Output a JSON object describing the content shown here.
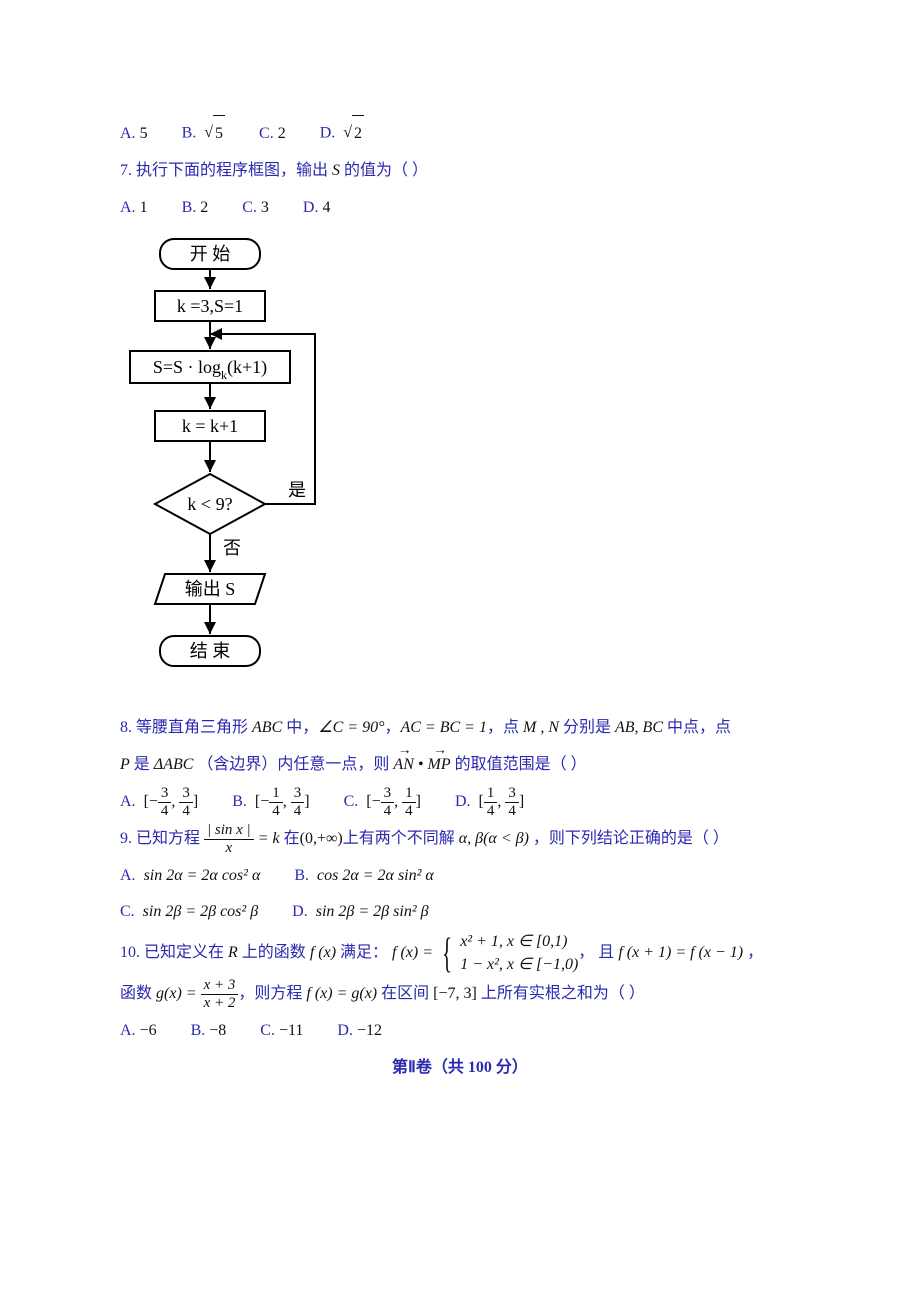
{
  "q6": {
    "a_label": "A.",
    "a_val": "5",
    "b_label": "B.",
    "b_sqrt": "5",
    "c_label": "C.",
    "c_val": "2",
    "d_label": "D.",
    "d_sqrt": "2"
  },
  "q7": {
    "num": "7.",
    "text": "执行下面的程序框图，输出",
    "svar": "S",
    "text2": "的值为（     ）",
    "a_label": "A.",
    "a_val": "1",
    "b_label": "B.",
    "b_val": "2",
    "c_label": "C.",
    "c_val": "3",
    "d_label": "D.",
    "d_val": "4",
    "flow": {
      "start": "开  始",
      "init": "k =3,S=1",
      "step1_a": "S=S · log",
      "step1_sub": "k",
      "step1_b": "(k+1)",
      "step2": "k = k+1",
      "cond": "k < 9?",
      "yes": "是",
      "no": "否",
      "out": "输出 S",
      "end": "结  束"
    }
  },
  "q8": {
    "num": "8.",
    "t1": "等腰直角三角形",
    "abc": "ABC",
    "t2": "中，",
    "angle": "∠C = 90°",
    "comma1": "，",
    "eq": "AC = BC = 1",
    "t3": "，点",
    "mn": "M , N",
    "t4": "分别是",
    "abbc": "AB, BC",
    "t5": "中点，点",
    "pvar": "P",
    "t6": "是",
    "tri": "ΔABC",
    "t7": "（含边界）内任意一点，则",
    "vec1": "AN",
    "dot": "•",
    "vec2": "MP",
    "t8": "的取值范围是（     ）",
    "opts": {
      "a": "A.",
      "b": "B.",
      "c": "C.",
      "d": "D.",
      "n3": "3",
      "n1": "1",
      "d4": "4"
    }
  },
  "q9": {
    "num": "9.",
    "t1": "已知方程",
    "frac_num": "| sin x |",
    "frac_den": "x",
    "eqk": "= k",
    "t2": "在",
    "interval": "(0,+∞)",
    "t3": "上有两个不同解",
    "ab": "α, β(α < β)",
    "t4": "，则下列结论正确的是（     ）",
    "optA_l": "A.",
    "optA": "sin 2α = 2α cos² α",
    "optB_l": "B.",
    "optB": "cos 2α = 2α sin² α",
    "optC_l": "C.",
    "optC": "sin 2β = 2β cos² β",
    "optD_l": "D.",
    "optD": "sin 2β = 2β sin² β"
  },
  "q10": {
    "num": "10.",
    "t1": "已知定义在",
    "R": "R",
    "t2": "上的函数",
    "fx": "f (x)",
    "t3": "满足：",
    "fxeq": "f (x) =",
    "case1": "x² + 1, x ∈ [0,1)",
    "case2": "1 − x², x ∈ [−1,0)",
    "t4": "， 且",
    "period": "f (x + 1) = f (x − 1)",
    "t5": "，",
    "t6": "函数",
    "gx": "g(x) =",
    "gnum": "x + 3",
    "gden": "x + 2",
    "t7": "，则方程",
    "fxg": "f (x) = g(x)",
    "t8": "在区间",
    "int": "[−7, 3]",
    "t9": "上所有实根之和为（     ）",
    "a_l": "A.",
    "a": "−6",
    "b_l": "B.",
    "b": "−8",
    "c_l": "C.",
    "c": "−11",
    "d_l": "D.",
    "d": "−12"
  },
  "section": "第Ⅱ卷（共 100 分）"
}
